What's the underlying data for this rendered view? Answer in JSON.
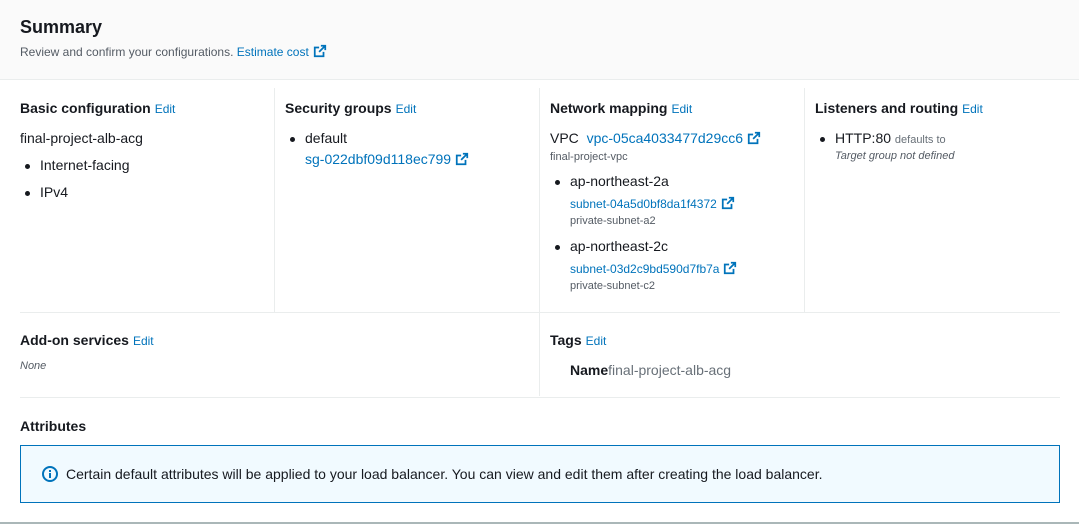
{
  "summary": {
    "title": "Summary",
    "description": "Review and confirm your configurations.",
    "estimate_cost": "Estimate cost"
  },
  "edit_label": "Edit",
  "basic": {
    "heading": "Basic configuration",
    "name": "final-project-alb-acg",
    "items": [
      "Internet-facing",
      "IPv4"
    ]
  },
  "security": {
    "heading": "Security groups",
    "group_name": "default",
    "group_id": "sg-022dbf09d118ec799"
  },
  "network": {
    "heading": "Network mapping",
    "vpc_label": "VPC",
    "vpc_id": "vpc-05ca4033477d29cc6",
    "vpc_name": "final-project-vpc",
    "zones": [
      {
        "az": "ap-northeast-2a",
        "subnet_id": "subnet-04a5d0bf8da1f4372",
        "subnet_name": "private-subnet-a2"
      },
      {
        "az": "ap-northeast-2c",
        "subnet_id": "subnet-03d2c9bd590d7fb7a",
        "subnet_name": "private-subnet-c2"
      }
    ]
  },
  "listeners": {
    "heading": "Listeners and routing",
    "listener": "HTTP:80",
    "defaults_to": "defaults to",
    "target": "Target group not defined"
  },
  "addons": {
    "heading": "Add-on services",
    "value": "None"
  },
  "tags": {
    "heading": "Tags",
    "key": "Name",
    "value": "final-project-alb-acg"
  },
  "attributes": {
    "heading": "Attributes",
    "info": "Certain default attributes will be applied to your load balancer. You can view and edit them after creating the load balancer."
  },
  "colors": {
    "link": "#0073bb",
    "info_bg": "#f1faff",
    "border": "#eaeded"
  }
}
